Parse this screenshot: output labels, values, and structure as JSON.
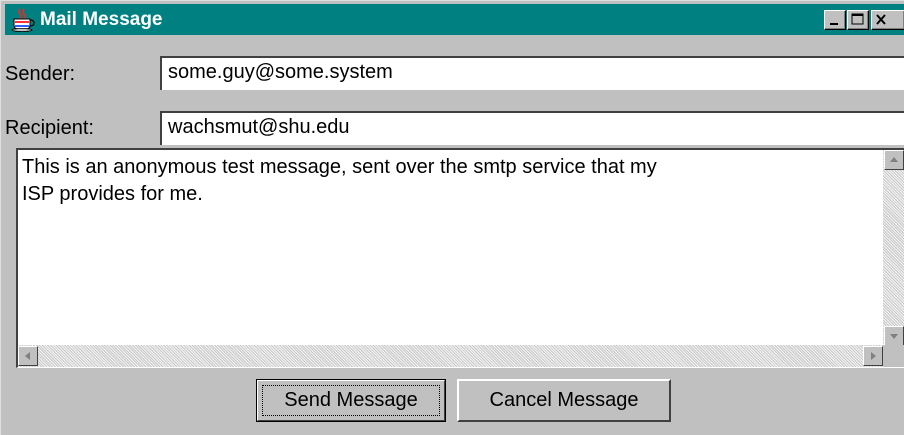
{
  "window": {
    "title": "Mail Message",
    "app_icon": "java-coffee-cup-icon",
    "controls": [
      "minimize-icon",
      "maximize-icon",
      "close-icon"
    ]
  },
  "form": {
    "sender_label": "Sender:",
    "sender_value": "some.guy@some.system",
    "recipient_label": "Recipient:",
    "recipient_value": "wachsmut@shu.edu",
    "message_body": "This is an anonymous test message, sent over the smtp service that my\nISP provides for me."
  },
  "buttons": {
    "send_label": "Send Message",
    "cancel_label": "Cancel Message"
  },
  "colors": {
    "title_bar": "#008080",
    "window_bg": "#c0c0c0"
  }
}
